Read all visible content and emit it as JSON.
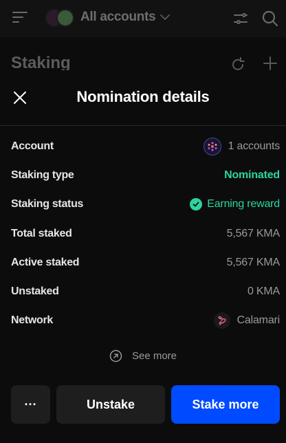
{
  "header": {
    "account_selector": "All accounts",
    "page_title": "Staking"
  },
  "sheet": {
    "title": "Nomination details",
    "rows": [
      {
        "label": "Account",
        "value": "1 accounts"
      },
      {
        "label": "Staking type",
        "value": "Nominated"
      },
      {
        "label": "Staking status",
        "value": "Earning reward"
      },
      {
        "label": "Total staked",
        "value": "5,567 KMA"
      },
      {
        "label": "Active staked",
        "value": "5,567 KMA"
      },
      {
        "label": "Unstaked",
        "value": "0 KMA"
      },
      {
        "label": "Network",
        "value": "Calamari"
      }
    ],
    "see_more": "See more"
  },
  "actions": {
    "more_label": "···",
    "unstake_label": "Unstake",
    "stake_more_label": "Stake more"
  },
  "colors": {
    "accent_blue": "#004bff",
    "success_green": "#2dd4a0",
    "background": "#0c0c0c",
    "button_dark": "#1e1e1e"
  },
  "icons": {
    "menu": "menu-icon",
    "filter": "sliders-icon",
    "search": "search-icon",
    "reload": "reload-icon",
    "add": "plus-icon",
    "close": "close-icon",
    "status": "check-circle-icon",
    "network": "calamari-icon",
    "see_more": "arrow-up-right-circle-icon"
  }
}
